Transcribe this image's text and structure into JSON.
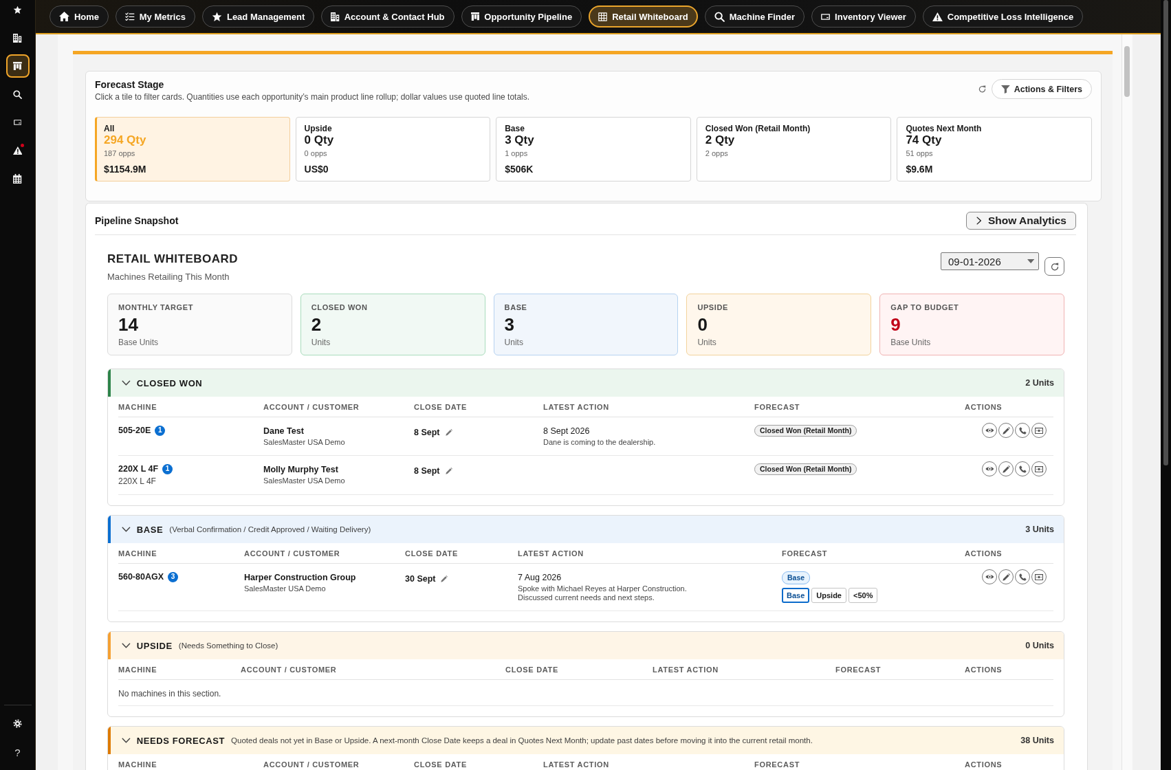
{
  "sidebar": {
    "items": [
      {
        "kind": "star",
        "selected": false,
        "notification": false
      },
      {
        "kind": "building",
        "selected": false,
        "notification": false
      },
      {
        "kind": "board",
        "selected": true,
        "notification": false
      },
      {
        "kind": "search",
        "selected": false,
        "notification": false
      },
      {
        "kind": "card",
        "selected": false,
        "notification": false
      },
      {
        "kind": "warning",
        "selected": false,
        "notification": true
      },
      {
        "kind": "calendar",
        "selected": false,
        "notification": false
      }
    ],
    "bottom_items": [
      {
        "kind": "settings"
      },
      {
        "kind": "help",
        "label": "?"
      }
    ]
  },
  "nav": {
    "tabs": [
      {
        "kind": "home",
        "label": "Home",
        "selected": false
      },
      {
        "kind": "metrics",
        "label": "My Metrics",
        "selected": false
      },
      {
        "kind": "star",
        "label": "Lead Management",
        "selected": false
      },
      {
        "kind": "building",
        "label": "Account & Contact Hub",
        "selected": false
      },
      {
        "kind": "board",
        "label": "Opportunity Pipeline",
        "selected": false
      },
      {
        "kind": "grid",
        "label": "Retail Whiteboard",
        "selected": true
      },
      {
        "kind": "search",
        "label": "Machine Finder",
        "selected": false
      },
      {
        "kind": "card",
        "label": "Inventory Viewer",
        "selected": false
      },
      {
        "kind": "warning",
        "label": "Competitive Loss Intelligence",
        "selected": false
      }
    ]
  },
  "forecast_stage": {
    "title": "Forecast Stage",
    "subtitle": "Click a tile to filter cards. Quantities use each opportunity’s main product line rollup; dollar values use quoted line totals.",
    "actions_button": "Actions & Filters",
    "tiles": [
      {
        "label": "All",
        "qty": "294 Qty",
        "opps": "187 opps",
        "amount": "$1154.9M",
        "selected": true
      },
      {
        "label": "Upside",
        "qty": "0 Qty",
        "opps": "0 opps",
        "amount": "US$0",
        "selected": false
      },
      {
        "label": "Base",
        "qty": "3 Qty",
        "opps": "1 opps",
        "amount": "$506K",
        "selected": false
      },
      {
        "label": "Closed Won (Retail Month)",
        "qty": "2 Qty",
        "opps": "2 opps",
        "selected": false
      },
      {
        "label": "Quotes Next Month",
        "qty": "74 Qty",
        "opps": "51 opps",
        "amount": "$9.6M",
        "selected": false
      }
    ]
  },
  "pipeline_snapshot": {
    "title": "Pipeline Snapshot",
    "analytics_button": "Show Analytics",
    "whiteboard": {
      "title": "RETAIL WHITEBOARD",
      "subtitle": "Machines Retailing This Month",
      "date": "09-01-2026",
      "kpis": [
        {
          "kind": "target",
          "label": "MONTHLY TARGET",
          "value": "14",
          "unit": "Base Units"
        },
        {
          "kind": "closed_won",
          "label": "CLOSED WON",
          "value": "2",
          "unit": "Units"
        },
        {
          "kind": "base",
          "label": "BASE",
          "value": "3",
          "unit": "Units"
        },
        {
          "kind": "upside",
          "label": "UPSIDE",
          "value": "0",
          "unit": "Units"
        },
        {
          "kind": "gap",
          "label": "GAP TO BUDGET",
          "value": "9",
          "unit": "Base Units"
        }
      ],
      "sections": [
        {
          "kind": "closed_won",
          "title": "CLOSED WON",
          "units": "2 Units",
          "expanded": true,
          "columns": [
            "MACHINE",
            "ACCOUNT / CUSTOMER",
            "CLOSE DATE",
            "LATEST ACTION",
            "FORECAST",
            "ACTIONS"
          ],
          "rows": [
            {
              "machine": "505-20E",
              "count": "1",
              "account": "Dane Test",
              "dealer": "SalesMaster USA Demo",
              "close_date": "8 Sept",
              "action_date": "8 Sept 2026",
              "action_note": "Dane is coming to the dealership.",
              "forecast": {
                "kind": "closed_won",
                "label": "Closed Won (Retail Month)"
              }
            },
            {
              "machine": "220X L 4F",
              "count": "1",
              "machine_detail": "220X L 4F",
              "account": "Molly Murphy Test",
              "dealer": "SalesMaster USA Demo",
              "close_date": "8 Sept",
              "forecast": {
                "kind": "closed_won",
                "label": "Closed Won (Retail Month)"
              }
            }
          ]
        },
        {
          "kind": "base",
          "title": "BASE",
          "note": "(Verbal Confirmation / Credit Approved / Waiting Delivery)",
          "units": "3 Units",
          "expanded": true,
          "columns": [
            "MACHINE",
            "ACCOUNT / CUSTOMER",
            "CLOSE DATE",
            "LATEST ACTION",
            "FORECAST",
            "ACTIONS"
          ],
          "rows": [
            {
              "machine": "560-80AGX",
              "count": "3",
              "account": "Harper Construction Group",
              "dealer": "SalesMaster USA Demo",
              "close_date": "30 Sept",
              "action_date": "7 Aug 2026",
              "action_note": "Spoke with Michael Reyes at Harper Construction. Discussed current needs and next steps.",
              "forecast": {
                "kind": "base",
                "label": "Base"
              },
              "forecast_options": [
                {
                  "label": "Base",
                  "selected": true
                },
                {
                  "label": "Upside",
                  "selected": false
                },
                {
                  "label": "<50%",
                  "selected": false
                }
              ]
            }
          ]
        },
        {
          "kind": "upside",
          "title": "UPSIDE",
          "note": "(Needs Something to Close)",
          "units": "0 Units",
          "expanded": true,
          "columns": [
            "MACHINE",
            "ACCOUNT / CUSTOMER",
            "CLOSE DATE",
            "LATEST ACTION",
            "FORECAST",
            "ACTIONS"
          ],
          "empty_message": "No machines in this section."
        },
        {
          "kind": "needs_forecast",
          "title": "NEEDS FORECAST",
          "note": "Quoted deals not yet in Base or Upside. A next-month Close Date keeps a deal in Quotes Next Month; update past dates before moving it into the current retail month.",
          "units": "38 Units",
          "expanded": true,
          "columns": [
            "MACHINE",
            "ACCOUNT / CUSTOMER",
            "CLOSE DATE",
            "LATEST ACTION",
            "FORECAST",
            "ACTIONS"
          ]
        }
      ]
    }
  }
}
